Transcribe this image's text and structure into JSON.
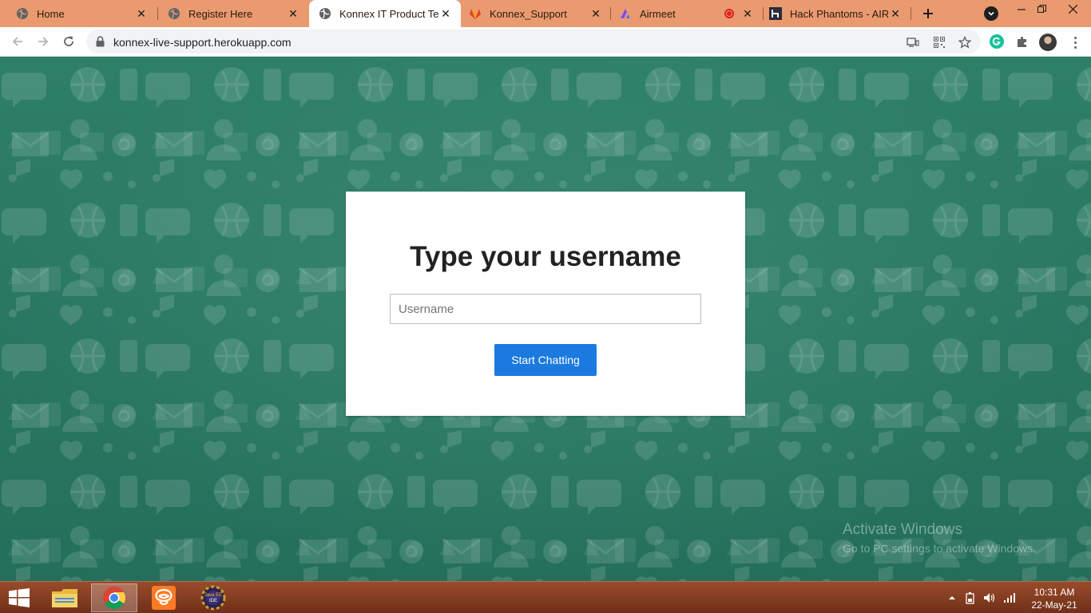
{
  "browser": {
    "tabs": [
      {
        "title": "Home",
        "icon": "globe-icon",
        "active": false
      },
      {
        "title": "Register Here",
        "icon": "globe-icon",
        "active": false
      },
      {
        "title": "Konnex IT Product Tean",
        "icon": "globe-icon",
        "active": true
      },
      {
        "title": "Konnex_Support",
        "icon": "gitlab-fox-icon",
        "active": false
      },
      {
        "title": "Airmeet",
        "icon": "airmeet-icon",
        "active": false,
        "recording": true
      },
      {
        "title": "Hack Phantoms - AIRBU",
        "icon": "h-logo-icon",
        "active": false
      }
    ],
    "new_tab_icon": "plus-icon",
    "address_bar": {
      "url": "konnex-live-support.herokuapp.com",
      "secure": true
    }
  },
  "page": {
    "heading": "Type your username",
    "username_input": {
      "placeholder": "Username",
      "value": ""
    },
    "start_button_label": "Start Chatting",
    "background_color": "#2a7763",
    "button_color": "#1a7ae0"
  },
  "watermark": {
    "title": "Activate Windows",
    "subtitle": "Go to PC settings to activate Windows."
  },
  "taskbar": {
    "apps": [
      "file-explorer-icon",
      "chrome-icon",
      "xampp-icon",
      "java-ee-ide-icon"
    ],
    "active_app": "chrome-icon",
    "clock": {
      "time": "10:31 AM",
      "date": "22-May-21"
    },
    "accent": "#8a3f22"
  }
}
